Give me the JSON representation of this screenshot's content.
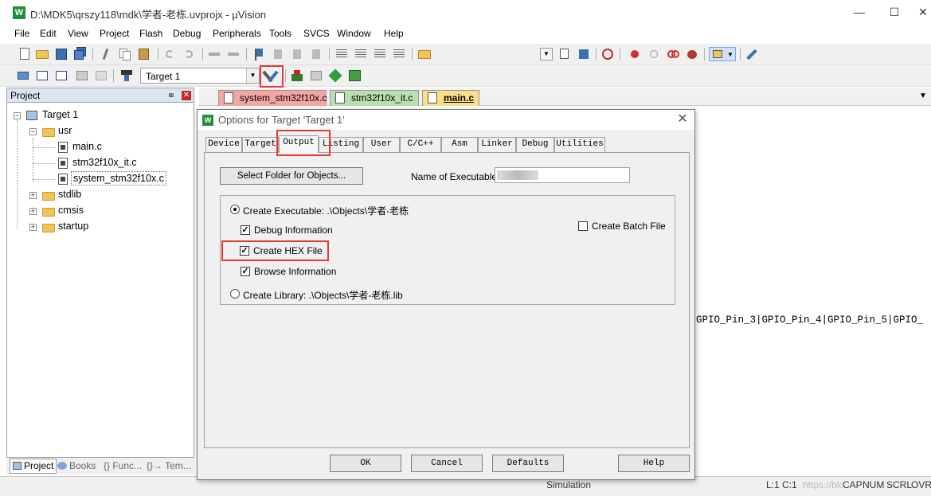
{
  "window": {
    "title": "D:\\MDK5\\qrszy118\\mdk\\学者-老栋.uvprojx - µVision",
    "app_icon": "W",
    "minimize": "—",
    "maximize": "☐",
    "close": "✕"
  },
  "menu": [
    "File",
    "Edit",
    "View",
    "Project",
    "Flash",
    "Debug",
    "Peripherals",
    "Tools",
    "SVCS",
    "Window",
    "Help"
  ],
  "build_toolbar": {
    "target_select": "Target 1"
  },
  "project_panel": {
    "title": "Project",
    "pin": "⩏",
    "close": "✕",
    "tree": {
      "root": "Target 1",
      "groups": [
        {
          "name": "usr",
          "files": [
            "main.c",
            "stm32f10x_it.c",
            "system_stm32f10x.c"
          ]
        },
        {
          "name": "stdlib"
        },
        {
          "name": "cmsis"
        },
        {
          "name": "startup"
        }
      ]
    },
    "bottom_tabs": [
      "Project",
      "Books",
      "{} Func...",
      "{}→ Tem..."
    ]
  },
  "editor": {
    "tabs": [
      {
        "label": "system_stm32f10x.c",
        "color": "#f4a6a6"
      },
      {
        "label": "stm32f10x_it.c",
        "color": "#b9dfb0"
      },
      {
        "label": "main.c",
        "color": "#f8e08a"
      }
    ],
    "visible_code": "GPIO_Pin_3|GPIO_Pin_4|GPIO_Pin_5|GPIO_"
  },
  "dialog": {
    "title": "Options for Target 'Target 1'",
    "close": "✕",
    "tabs": [
      "Device",
      "Target",
      "Output",
      "Listing",
      "User",
      "C/C++",
      "Asm",
      "Linker",
      "Debug",
      "Utilities"
    ],
    "active_tab": "Output",
    "select_folder_button": "Select Folder for Objects...",
    "name_of_executable_label": "Name of Executable:",
    "create_executable_label": "Create Executable:  .\\Objects\\学者-老栋",
    "debug_information_label": "Debug Information",
    "create_hex_file_label": "Create HEX File",
    "browse_information_label": "Browse Information",
    "create_library_label": "Create Library:  .\\Objects\\学者-老栋.lib",
    "create_batch_file_label": "Create Batch File",
    "options": {
      "create_executable": true,
      "debug_information": true,
      "create_hex_file": true,
      "browse_information": true,
      "create_library": false,
      "create_batch_file": false
    },
    "buttons": {
      "ok": "OK",
      "cancel": "Cancel",
      "defaults": "Defaults",
      "help": "Help"
    }
  },
  "statusbar": {
    "mode": "Simulation",
    "position": "L:1 C:1",
    "watermark": "https://blog.csdn.net/rainbowd...",
    "indicators": [
      "CAP",
      "NUM",
      "SCRL",
      "OVR"
    ]
  },
  "colors": {
    "highlight": "#e53935",
    "panel_header": "#dbe5f1"
  }
}
